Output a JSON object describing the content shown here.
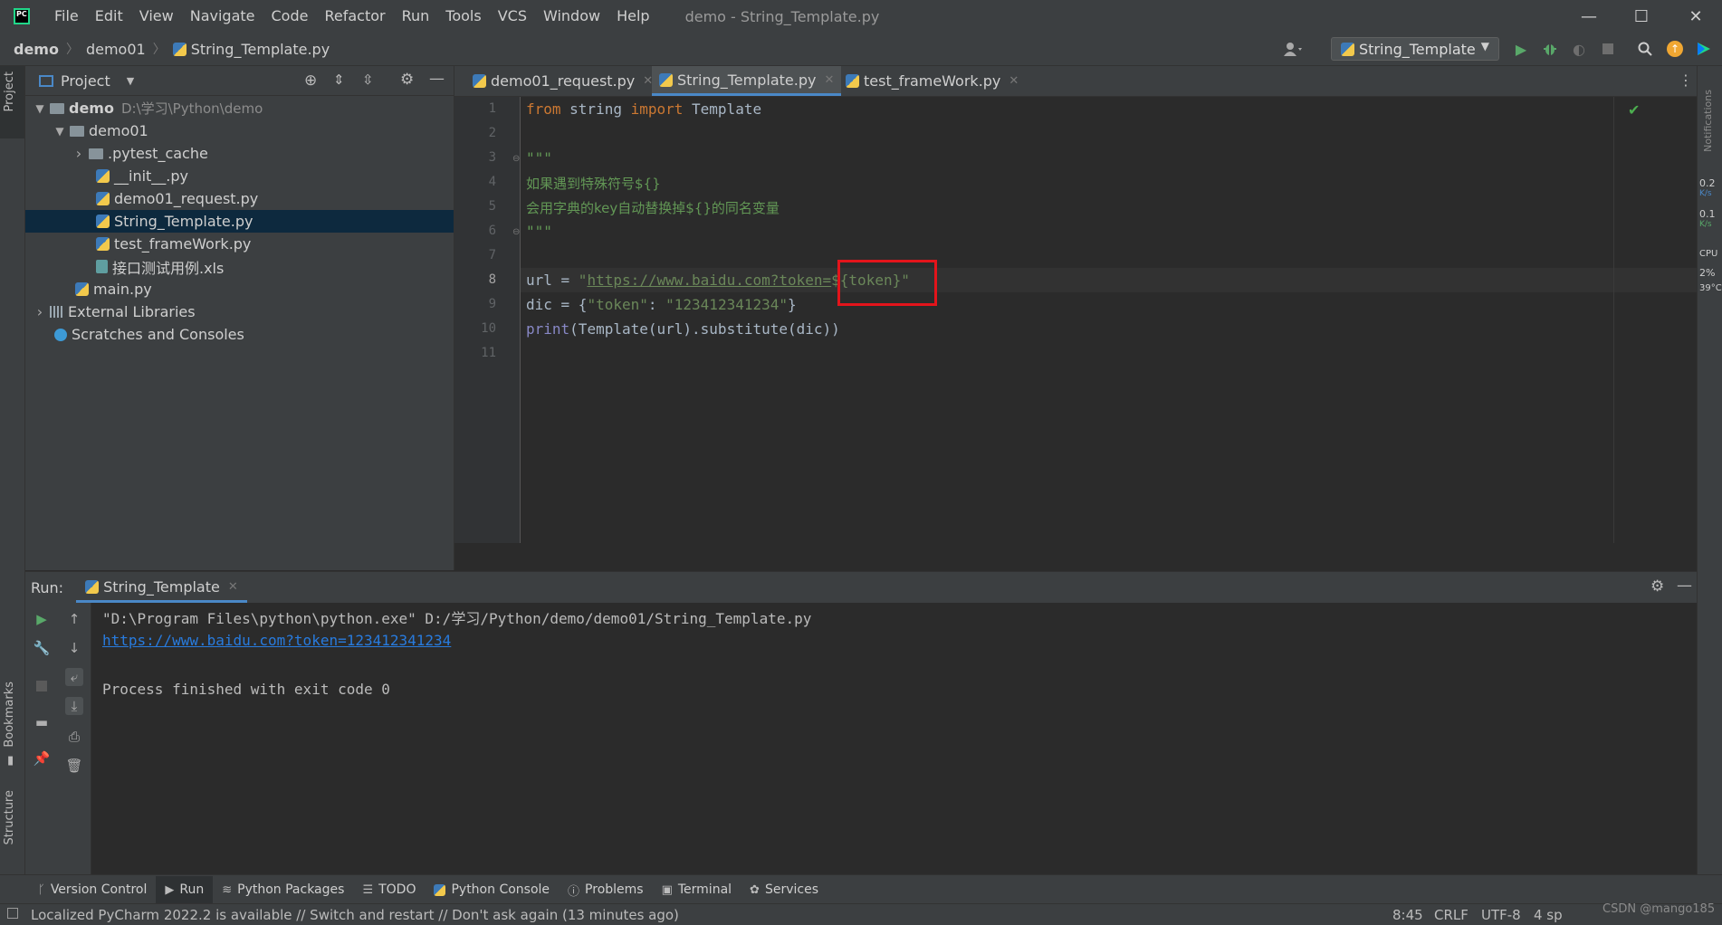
{
  "window": {
    "title": "demo - String_Template.py",
    "menu": [
      "File",
      "Edit",
      "View",
      "Navigate",
      "Code",
      "Refactor",
      "Run",
      "Tools",
      "VCS",
      "Window",
      "Help"
    ],
    "controls": {
      "minimize": "—",
      "maximize": "☐",
      "close": "✕"
    }
  },
  "breadcrumb": [
    "demo",
    "demo01",
    "String_Template.py"
  ],
  "run_config": {
    "label": "String_Template"
  },
  "project_panel": {
    "title": "Project",
    "tree": [
      {
        "label": "demo",
        "hint": "D:\\学习\\Python\\demo",
        "icon": "folder-icon",
        "arrow": "▼"
      },
      {
        "label": "demo01",
        "icon": "folder-icon",
        "arrow": "▼"
      },
      {
        "label": ".pytest_cache",
        "icon": "folder-icon",
        "arrow": "›"
      },
      {
        "label": "__init__.py",
        "icon": "python-file-icon"
      },
      {
        "label": "demo01_request.py",
        "icon": "python-file-icon"
      },
      {
        "label": "String_Template.py",
        "icon": "python-file-icon",
        "selected": true
      },
      {
        "label": "test_frameWork.py",
        "icon": "python-file-icon"
      },
      {
        "label": "接口测试用例.xls",
        "icon": "excel-file-icon"
      },
      {
        "label": "main.py",
        "icon": "python-file-icon"
      },
      {
        "label": "External Libraries",
        "icon": "library-icon",
        "arrow": "›"
      },
      {
        "label": "Scratches and Consoles",
        "icon": "scratches-icon"
      }
    ]
  },
  "editor": {
    "tabs": [
      {
        "label": "demo01_request.py",
        "active": false
      },
      {
        "label": "String_Template.py",
        "active": true
      },
      {
        "label": "test_frameWork.py",
        "active": false
      }
    ],
    "line_numbers": [
      "1",
      "2",
      "3",
      "4",
      "5",
      "6",
      "7",
      "8",
      "9",
      "10",
      "11"
    ],
    "current_line": "8",
    "code": {
      "l1_from": "from",
      "l1_mid": " string ",
      "l1_import": "import",
      "l1_end": " Template",
      "l3": "\"\"\"",
      "l4": "如果遇到特殊符号${}",
      "l5": "会用字典的key自动替换掉${}的同名变量",
      "l6": "\"\"\"",
      "l8_pre": "url = ",
      "l8_q1": "\"",
      "l8_url": "https://www.baidu.com?token=",
      "l8_tpl": "${token}",
      "l8_q2": "\"",
      "l9_pre": "dic = {",
      "l9_key": "\"token\"",
      "l9_colon": ": ",
      "l9_val": "\"123412341234\"",
      "l9_end": "}",
      "l10_print": "print",
      "l10_rest": "(Template(url).substitute(dic))"
    }
  },
  "run_panel": {
    "label": "Run:",
    "tab": "String_Template",
    "console": {
      "cmd": "\"D:\\Program Files\\python\\python.exe\" D:/学习/Python/demo/demo01/String_Template.py",
      "output_link": "https://www.baidu.com?token=123412341234",
      "finish": "Process finished with exit code 0"
    }
  },
  "tool_tabs": [
    {
      "label": "Version Control",
      "icon": "git-branch-icon",
      "active": false
    },
    {
      "label": "Run",
      "icon": "run-icon",
      "active": true
    },
    {
      "label": "Python Packages",
      "icon": "packages-icon",
      "active": false
    },
    {
      "label": "TODO",
      "icon": "todo-icon",
      "active": false
    },
    {
      "label": "Python Console",
      "icon": "python-console-icon",
      "active": false
    },
    {
      "label": "Problems",
      "icon": "problems-icon",
      "active": false
    },
    {
      "label": "Terminal",
      "icon": "terminal-icon",
      "active": false
    },
    {
      "label": "Services",
      "icon": "services-icon",
      "active": false
    }
  ],
  "side_tabs": {
    "left_top": "Project",
    "bookmarks": "Bookmarks",
    "structure": "Structure",
    "notifications": "Notifications"
  },
  "right_strip": {
    "net_up": "0.2",
    "net_up_unit": "K/s",
    "net_down": "0.1",
    "net_down_unit": "K/s",
    "cpu_label": "CPU",
    "cpu_value": "2%",
    "temp": "39°C"
  },
  "statusbar": {
    "message": "Localized PyCharm 2022.2 is available // Switch and restart // Don't ask again (13 minutes ago)",
    "position": "8:45",
    "line_sep": "CRLF",
    "encoding": "UTF-8",
    "indent": "4 sp",
    "watermark": "CSDN @mango185"
  },
  "colors": {
    "accent": "#4a88c7",
    "highlight_box": "#e3141b",
    "link": "#287bde"
  }
}
